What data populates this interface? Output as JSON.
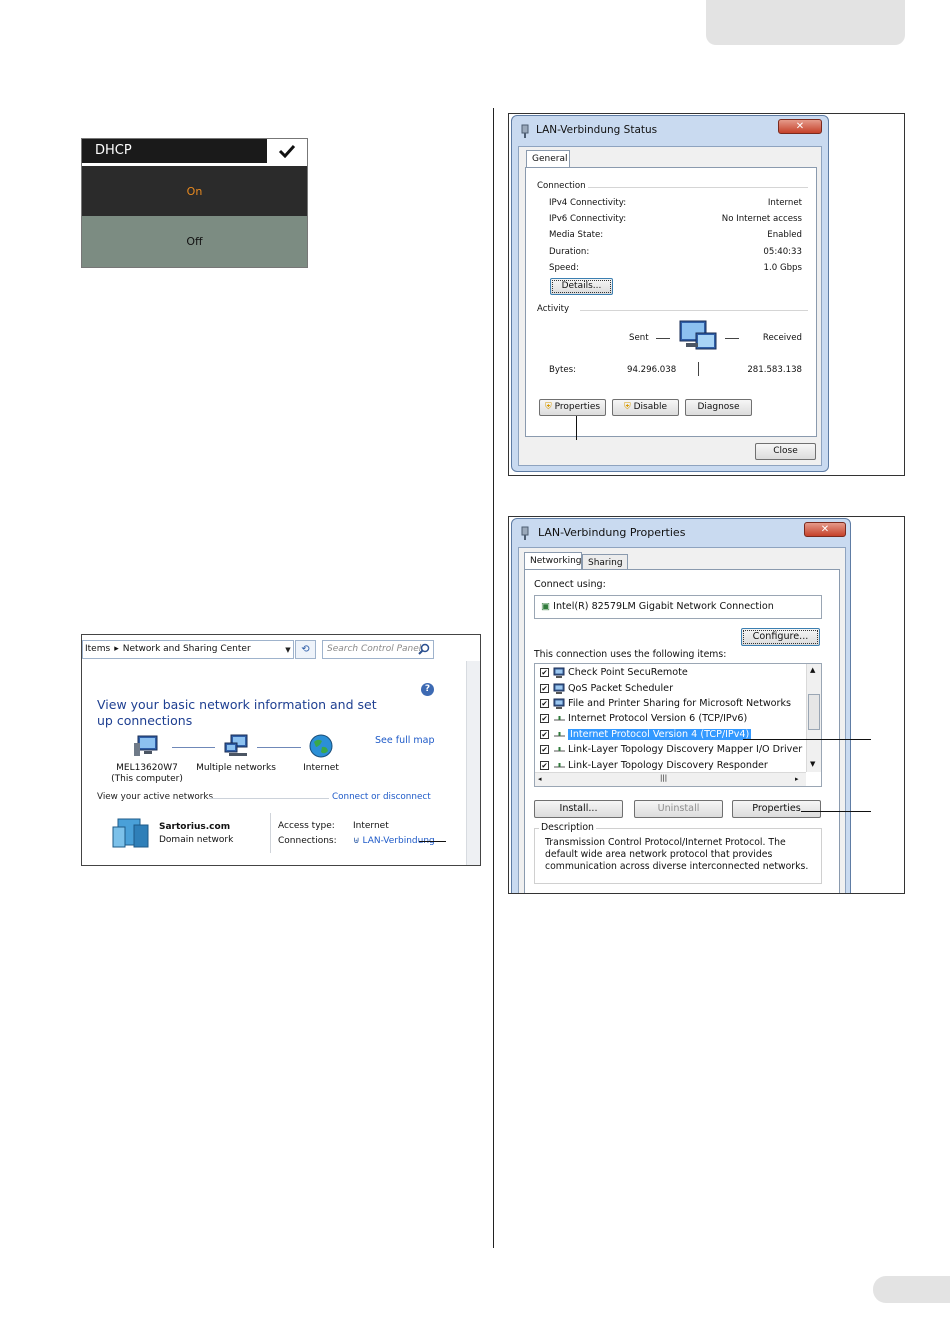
{
  "dhcp": {
    "title": "DHCP",
    "options": [
      "On",
      "Off"
    ]
  },
  "nsc": {
    "breadcrumb": [
      "Items",
      "Network and Sharing Center"
    ],
    "search_placeholder": "Search Control Panel",
    "heading": "View your basic network information and set up connections",
    "see_full_map": "See full map",
    "nodes": [
      {
        "label": "MEL13620W7",
        "sub": "(This computer)",
        "icon": "computer-icon"
      },
      {
        "label": "Multiple networks",
        "icon": "network-icon"
      },
      {
        "label": "Internet",
        "icon": "globe-icon"
      }
    ],
    "active_networks_label": "View your active networks",
    "connect_link": "Connect or disconnect",
    "network_name": "Sartorius.com",
    "network_type": "Domain network",
    "access_type_label": "Access type:",
    "access_type_value": "Internet",
    "connections_label": "Connections:",
    "connections_value": "LAN-Verbindung"
  },
  "status": {
    "title": "LAN-Verbindung Status",
    "tab": "General",
    "connection_group": "Connection",
    "rows": [
      {
        "label": "IPv4 Connectivity:",
        "value": "Internet"
      },
      {
        "label": "IPv6 Connectivity:",
        "value": "No Internet access"
      },
      {
        "label": "Media State:",
        "value": "Enabled"
      },
      {
        "label": "Duration:",
        "value": "05:40:33"
      },
      {
        "label": "Speed:",
        "value": "1.0 Gbps"
      }
    ],
    "details_button": "Details...",
    "activity_group": "Activity",
    "sent_label": "Sent",
    "received_label": "Received",
    "bytes_label": "Bytes:",
    "bytes_sent": "94.296.038",
    "bytes_received": "281.583.138",
    "properties_button": "Properties",
    "disable_button": "Disable",
    "diagnose_button": "Diagnose",
    "close_button": "Close"
  },
  "props": {
    "title": "LAN-Verbindung Properties",
    "tabs": [
      "Networking",
      "Sharing"
    ],
    "connect_using_label": "Connect using:",
    "adapter": "Intel(R) 82579LM Gigabit Network Connection",
    "configure_button": "Configure...",
    "items_label": "This connection uses the following items:",
    "items": [
      {
        "label": "Check Point SecuRemote",
        "checked": true,
        "icon": "network-client-icon"
      },
      {
        "label": "QoS Packet Scheduler",
        "checked": true,
        "icon": "network-client-icon"
      },
      {
        "label": "File and Printer Sharing for Microsoft Networks",
        "checked": true,
        "icon": "network-client-icon"
      },
      {
        "label": "Internet Protocol Version 6 (TCP/IPv6)",
        "checked": true,
        "icon": "protocol-icon"
      },
      {
        "label": "Internet Protocol Version 4 (TCP/IPv4)",
        "checked": true,
        "icon": "protocol-icon",
        "selected": true
      },
      {
        "label": "Link-Layer Topology Discovery Mapper I/O Driver",
        "checked": true,
        "icon": "protocol-icon"
      },
      {
        "label": "Link-Layer Topology Discovery Responder",
        "checked": true,
        "icon": "protocol-icon"
      }
    ],
    "install_button": "Install...",
    "uninstall_button": "Uninstall",
    "properties_button": "Properties",
    "description_group": "Description",
    "description_text": "Transmission Control Protocol/Internet Protocol. The default wide area network protocol that provides communication across diverse interconnected networks."
  },
  "colors": {
    "dhcp_on": "#e8891f",
    "link_blue": "#1e5ac8",
    "selection": "#3399ff",
    "window_frame": "#c9daf0"
  }
}
